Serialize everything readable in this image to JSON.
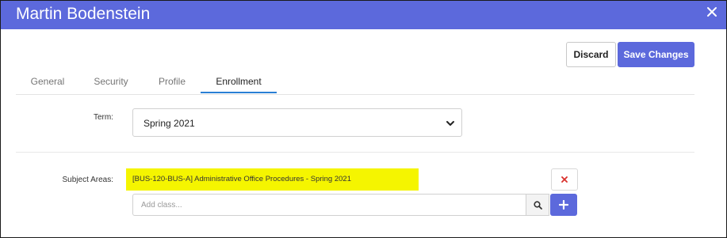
{
  "dialog": {
    "title": "Martin Bodenstein",
    "accent_color": "#5c69dc",
    "close_icon": "close-icon"
  },
  "toolbar": {
    "discard_label": "Discard",
    "save_label": "Save Changes"
  },
  "tabs": [
    {
      "label": "General",
      "active": false
    },
    {
      "label": "Security",
      "active": false
    },
    {
      "label": "Profile",
      "active": false
    },
    {
      "label": "Enrollment",
      "active": true
    }
  ],
  "enrollment": {
    "term_label": "Term:",
    "term_value": "Spring 2021",
    "subject_areas_label": "Subject Areas:",
    "classes": [
      {
        "label": "[BUS-120-BUS-A] Administrative Office Procedures - Spring 2021",
        "highlight_color": "#f5f500"
      }
    ],
    "add_class_placeholder": "Add class..."
  }
}
